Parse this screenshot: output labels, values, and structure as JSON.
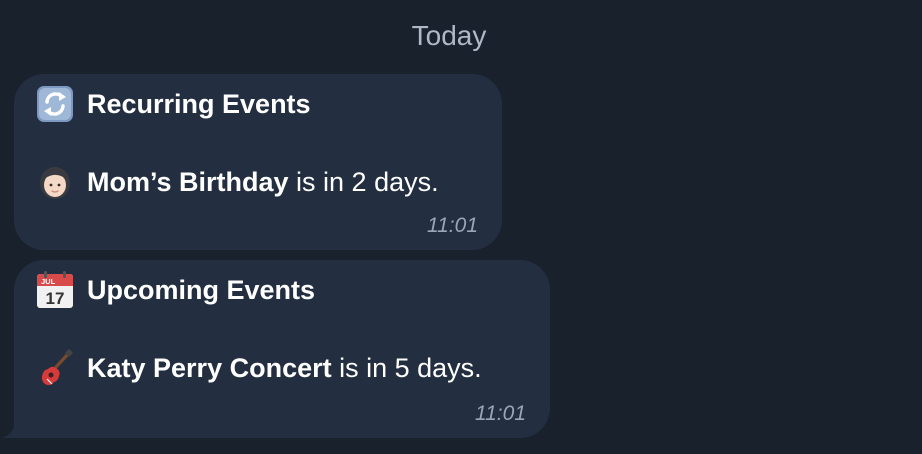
{
  "date_separator": "Today",
  "messages": [
    {
      "title_icon": "recurring-arrows-icon",
      "title": "Recurring Events",
      "event_icon": "woman-face-icon",
      "event_name": "Mom’s Birthday",
      "event_suffix": " is in 2 days.",
      "time": "11:01"
    },
    {
      "title_icon": "calendar-icon",
      "calendar_month": "JUL",
      "calendar_day": "17",
      "title": "Upcoming Events",
      "event_icon": "guitar-icon",
      "event_name": "Katy Perry Concert",
      "event_suffix": " is in 5 days.",
      "time": "11:01"
    }
  ]
}
